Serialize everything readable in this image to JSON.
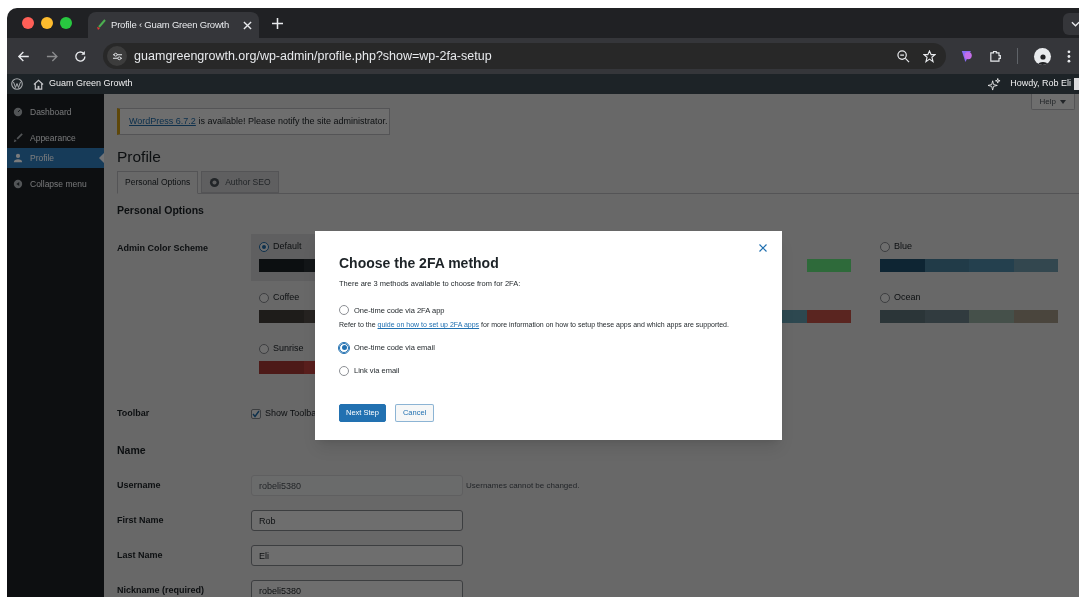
{
  "browser": {
    "tab_title": "Profile ‹ Guam Green Growth",
    "url": "guamgreengrowth.org/wp-admin/profile.php?show=wp-2fa-setup"
  },
  "admin_bar": {
    "site_name": "Guam Green Growth",
    "greeting": "Howdy, Rob Eli"
  },
  "sidebar": {
    "items": [
      {
        "label": "Dashboard",
        "kind": "dashboard",
        "selected": false
      },
      {
        "label": "Appearance",
        "kind": "brush",
        "selected": false
      },
      {
        "label": "Profile",
        "kind": "person",
        "selected": true
      },
      {
        "label": "Collapse menu",
        "kind": "collapse",
        "selected": false
      }
    ]
  },
  "help_tab": "Help",
  "notice": {
    "link": "WordPress 6.7.2",
    "text": " is available! Please notify the site administrator."
  },
  "page_title": "Profile",
  "tabs": [
    {
      "label": "Personal Options",
      "kind": "plain",
      "selected": true
    },
    {
      "label": "Author SEO",
      "kind": "gear",
      "selected": false
    }
  ],
  "section_title": "Personal Options",
  "color_scheme": {
    "label": "Admin Color Scheme",
    "rows": [
      [
        {
          "label": "Default",
          "selected": true,
          "swatches": [
            {
              "color": "#0c0f11"
            },
            {
              "color": "#131618"
            }
          ]
        },
        null,
        {
          "swatches": [
            {
              "color": "#2e6a3a"
            }
          ]
        },
        {
          "label": "Blue",
          "selected": false,
          "swatches": [
            {
              "color": "#0e2533"
            },
            {
              "color": "#213b48"
            },
            {
              "color": "#24404e"
            },
            {
              "color": "#33474f"
            }
          ]
        }
      ],
      [
        {
          "label": "Coffee",
          "selected": false,
          "swatches": [
            {
              "color": "#1e1c1a"
            },
            {
              "color": "#262321"
            }
          ]
        },
        null,
        {
          "swatches": [
            {
              "color": "#2d4850"
            },
            {
              "color": "#5a2520"
            }
          ]
        },
        {
          "label": "Ocean",
          "selected": false,
          "swatches": [
            {
              "color": "#2b3538"
            },
            {
              "color": "#313b3f"
            },
            {
              "color": "#45504a"
            },
            {
              "color": "#4a453d"
            }
          ]
        }
      ],
      [
        {
          "label": "Sunrise",
          "selected": false,
          "swatches": [
            {
              "color": "#4d1a18"
            },
            {
              "color": "#591f1d"
            }
          ]
        }
      ]
    ]
  },
  "toolbar": {
    "label": "Toolbar",
    "option": "Show Toolba",
    "checked": true
  },
  "name_title": "Name",
  "fields": [
    {
      "label": "Username",
      "value": "robeli5380",
      "disabled": true,
      "note": "Usernames cannot be changed."
    },
    {
      "label": "First Name",
      "value": "Rob",
      "disabled": false
    },
    {
      "label": "Last Name",
      "value": "Eli",
      "disabled": false
    },
    {
      "label": "Nickname (required)",
      "value": "robeli5380",
      "disabled": false
    }
  ],
  "modal": {
    "title": "Choose the 2FA method",
    "intro": "There are 3 methods available to choose from for 2FA:",
    "options": [
      {
        "label": "One-time code via 2FA app",
        "selected": false,
        "help": {
          "before": "Refer to the ",
          "link": "guide on how to set up 2FA apps",
          "after": " for more information on how to setup these apps and which apps are supported."
        }
      },
      {
        "label": "One-time code via email",
        "selected": true
      },
      {
        "label": "Link via email",
        "selected": false
      }
    ],
    "buttons": [
      {
        "label": "Next Step",
        "kind": "primary"
      },
      {
        "label": "Cancel",
        "kind": "secondary"
      }
    ]
  }
}
